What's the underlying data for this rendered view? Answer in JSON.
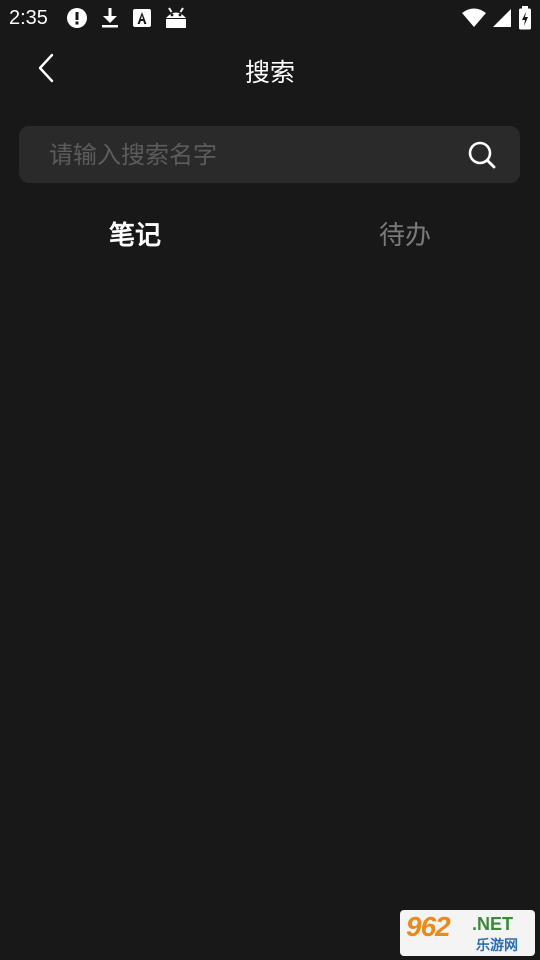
{
  "status_bar": {
    "time": "2:35",
    "left_icons": [
      "alert-icon",
      "download-icon",
      "font-a-icon",
      "android-icon"
    ],
    "right_icons": [
      "wifi-icon",
      "signal-icon",
      "battery-charging-icon"
    ]
  },
  "header": {
    "back_icon": "chevron-left-icon",
    "title": "搜索"
  },
  "search": {
    "placeholder": "请输入搜索名字",
    "value": "",
    "icon": "search-icon"
  },
  "tabs": [
    {
      "label": "笔记",
      "selected": true
    },
    {
      "label": "待办",
      "selected": false
    }
  ],
  "colors": {
    "background": "#181818",
    "search_bg": "#2a2a2a",
    "active_tab": "#ffffff",
    "inactive_tab": "#7a7a7a"
  },
  "watermark": {
    "number": "962",
    "suffix": ".NET",
    "cn": "乐游网"
  }
}
